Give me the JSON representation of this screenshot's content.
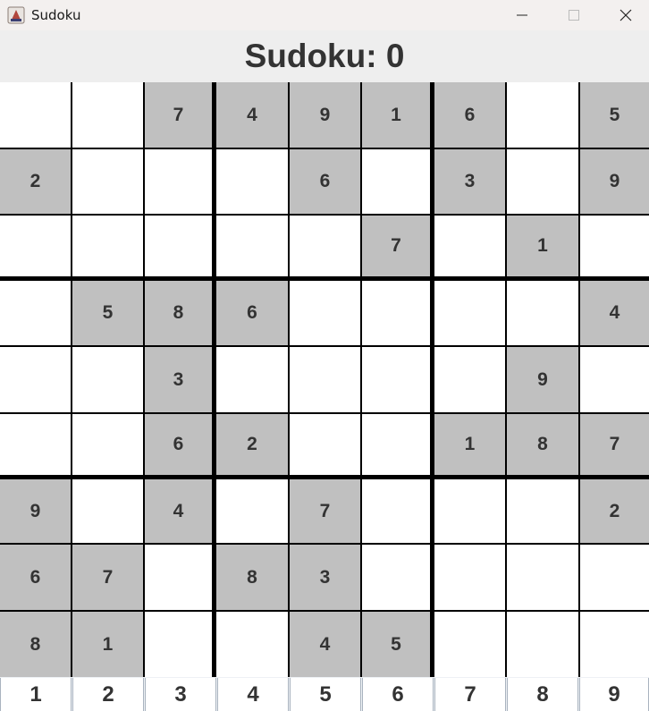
{
  "window": {
    "title": "Sudoku"
  },
  "header": {
    "title": "Sudoku: 0"
  },
  "board": {
    "rows": [
      [
        "",
        "",
        "7",
        "4",
        "9",
        "1",
        "6",
        "",
        "5"
      ],
      [
        "2",
        "",
        "",
        "",
        "6",
        "",
        "3",
        "",
        "9"
      ],
      [
        "",
        "",
        "",
        "",
        "",
        "7",
        "",
        "1",
        ""
      ],
      [
        "",
        "5",
        "8",
        "6",
        "",
        "",
        "",
        "",
        "4"
      ],
      [
        "",
        "",
        "3",
        "",
        "",
        "",
        "",
        "9",
        ""
      ],
      [
        "",
        "",
        "6",
        "2",
        "",
        "",
        "1",
        "8",
        "7"
      ],
      [
        "9",
        "",
        "4",
        "",
        "7",
        "",
        "",
        "",
        "2"
      ],
      [
        "6",
        "7",
        "",
        "8",
        "3",
        "",
        "",
        "",
        ""
      ],
      [
        "8",
        "1",
        "",
        "",
        "4",
        "5",
        "",
        "",
        ""
      ]
    ],
    "given_color": "#c0c0c0",
    "empty_color": "#ffffff"
  },
  "palette": {
    "numbers": [
      "1",
      "2",
      "3",
      "4",
      "5",
      "6",
      "7",
      "8",
      "9"
    ]
  }
}
